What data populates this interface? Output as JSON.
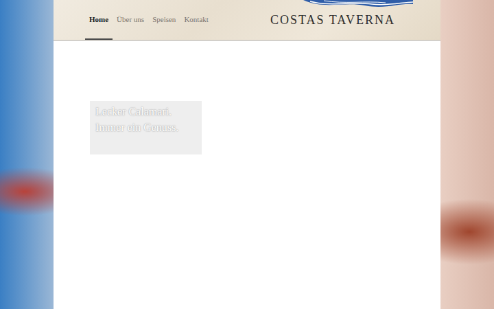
{
  "nav": {
    "items": [
      {
        "label": "Home",
        "selected": true
      },
      {
        "label": "Über uns",
        "selected": false
      },
      {
        "label": "Speisen",
        "selected": false
      },
      {
        "label": "Kontakt",
        "selected": false
      }
    ]
  },
  "logo": {
    "text": "COSTAS TAVERNA"
  },
  "hero": {
    "text": "Lecker Calamari. Immer ein Genuss."
  }
}
